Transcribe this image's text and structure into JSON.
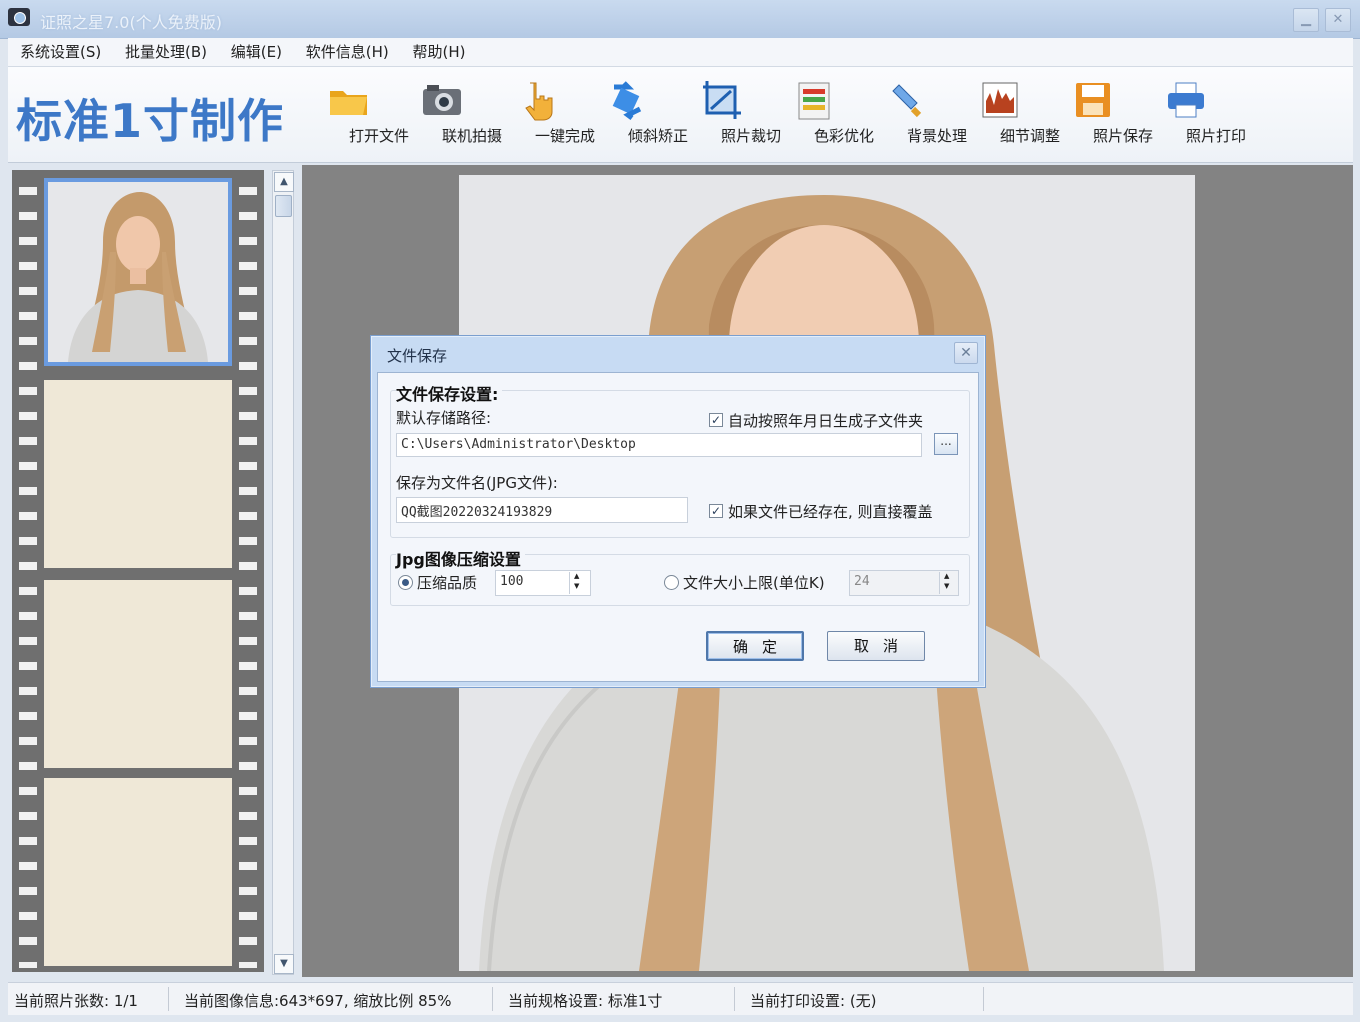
{
  "window": {
    "title": "证照之星7.0(个人免费版)"
  },
  "menu": [
    "系统设置(S)",
    "批量处理(B)",
    "编辑(E)",
    "软件信息(H)",
    "帮助(H)"
  ],
  "toolbar": {
    "mode_title": "标准1寸制作",
    "tools": [
      {
        "label": "打开文件",
        "icon": "open-folder-icon"
      },
      {
        "label": "联机拍摄",
        "icon": "camera-icon"
      },
      {
        "label": "一键完成",
        "icon": "hand-pointer-icon"
      },
      {
        "label": "倾斜矫正",
        "icon": "rotate-icon"
      },
      {
        "label": "照片裁切",
        "icon": "crop-icon"
      },
      {
        "label": "色彩优化",
        "icon": "color-palette-icon"
      },
      {
        "label": "背景处理",
        "icon": "brush-icon"
      },
      {
        "label": "细节调整",
        "icon": "histogram-icon"
      },
      {
        "label": "照片保存",
        "icon": "save-icon"
      },
      {
        "label": "照片打印",
        "icon": "printer-icon"
      }
    ]
  },
  "status": {
    "count": "当前照片张数: 1/1",
    "image_info": "当前图像信息:643*697, 缩放比例 85%",
    "spec": "当前规格设置: 标准1寸",
    "print": "当前打印设置: (无)"
  },
  "dialog": {
    "title": "文件保存",
    "file_group_title": "文件保存设置:",
    "default_path_label": "默认存储路径:",
    "auto_subfolder_label": "自动按照年月日生成子文件夹",
    "auto_subfolder_checked": true,
    "path_value": "C:\\Users\\Administrator\\Desktop",
    "browse_label": "...",
    "filename_label": "保存为文件名(JPG文件):",
    "filename_value": "QQ截图20220324193829",
    "overwrite_label": "如果文件已经存在, 则直接覆盖",
    "overwrite_checked": true,
    "jpg_group_title": "Jpg图像压缩设置",
    "quality_label": "压缩品质",
    "quality_value": "100",
    "quality_selected": true,
    "size_limit_label": "文件大小上限(单位K)",
    "size_limit_value": "24",
    "ok_label": "确定",
    "cancel_label": "取消"
  },
  "colors": {
    "mode_title": "#3d78c7",
    "canvas_bg": "#838383",
    "film": "#6f6f6f",
    "selection_border": "#6a9be0",
    "dialog_frame": "#c7dbf3"
  }
}
